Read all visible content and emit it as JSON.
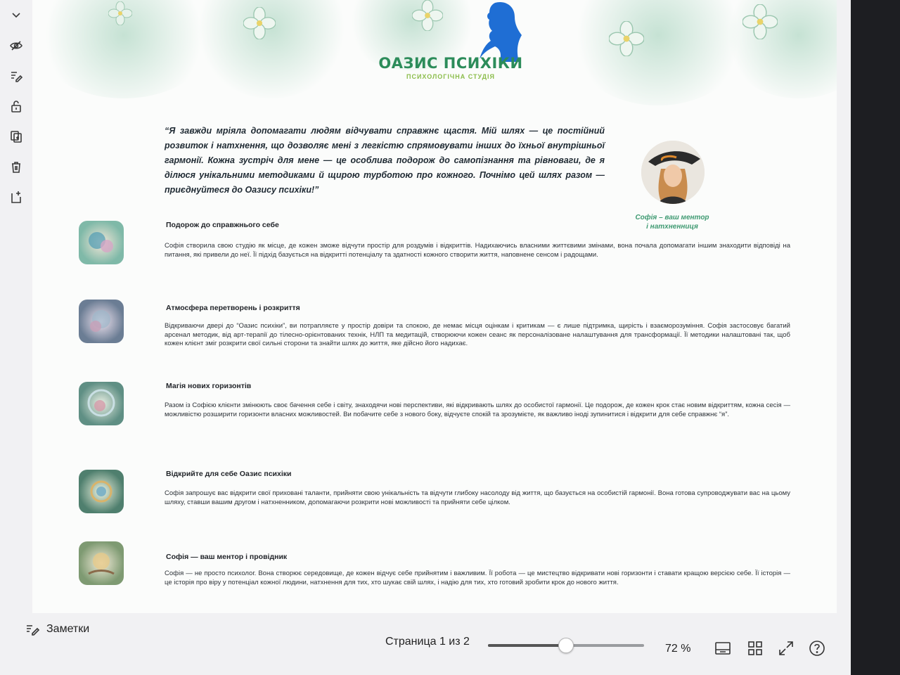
{
  "toolbar": {
    "items": [
      {
        "icon": "chevron-down-icon"
      },
      {
        "icon": "eye-off-icon"
      },
      {
        "icon": "edit-text-icon"
      },
      {
        "icon": "unlock-icon"
      },
      {
        "icon": "duplicate-page-icon"
      },
      {
        "icon": "trash-icon"
      },
      {
        "icon": "add-page-icon"
      }
    ]
  },
  "document": {
    "logo_title": "ОАЗИС ПСИХІКИ",
    "logo_subtitle": "ПСИХОЛОГІЧНА СТУДІЯ",
    "quote": "“Я завжди мріяла допомагати людям відчувати справжнє щастя. Мій шлях — це постійний розвиток і натхнення, що дозволяє мені з легкістю спрямовувати інших до їхньої внутрішньої гармонії. Кожна зустріч для мене — це особлива подорож до самопізнання та рівноваги, де я ділюся унікальними методиками й щирою турботою про кожного. Почнімо цей шлях разом — приєднуйтеся до Оазису психіки!”",
    "portrait_caption_line1": "Софія – ваш ментор",
    "portrait_caption_line2": "і натхненниця",
    "sections": [
      {
        "title": "Подорож до справжнього себе",
        "text": "Софія створила свою студію як місце, де кожен зможе відчути простір для роздумів і відкриттів. Надихаючись власними життєвими змінами, вона почала допомагати іншим знаходити відповіді на питання, які привели до неї. Її підхід базується на відкритті потенціалу та здатності кожного створити життя, наповнене сенсом і радощами."
      },
      {
        "title": "Атмосфера перетворень і розкриття",
        "text": "Відкриваючи двері до “Оазис психіки”, ви потрапляєте у простір довіри та спокою, де немає місця оцінкам і критикам — є лише підтримка, щирість і взаєморозуміння. Софія застосовує багатий арсенал методик, від арт-терапії до тілесно-орієнтованих технік, НЛП та медитацій, створюючи кожен сеанс як персоналізоване налаштування для трансформації. Її методики налаштовані так, щоб кожен клієнт зміг розкрити свої сильні сторони та знайти шлях до життя, яке дійсно його надихає."
      },
      {
        "title": "Магія нових горизонтів",
        "text": "Разом із Софією клієнти змінюють своє бачення себе і світу, знаходячи нові перспективи, які відкривають шлях до особистої гармонії. Це подорож, де кожен крок стає новим відкриттям, кожна сесія — можливістю розширити горизонти власних можливостей. Ви побачите себе з нового боку, відчуєте спокій та зрозумієте, як важливо іноді зупинитися і відкрити для себе справжнє “я”."
      },
      {
        "title": "Відкрийте для себе Оазис психіки",
        "text": "Софія запрошує вас відкрити свої приховані таланти, прийняти свою унікальність та відчути глибоку насолоду від життя, що базується на особистій гармонії. Вона готова супроводжувати вас на цьому шляху, ставши вашим другом і натхненником, допомагаючи розкрити нові можливості та прийняти себе цілком."
      },
      {
        "title": "Софія — ваш ментор і провідник",
        "text": "Софія — не просто психолог. Вона створює середовище, де кожен відчує себе прийнятим і важливим. Її робота — це мистецтво відкривати нові горизонти і ставати кращою версією себе. Її історія — це історія про віру у потенціал кожної людини, натхнення для тих, хто шукає свій шлях, і надію для тих, хто готовий зробити крок до нового життя."
      }
    ]
  },
  "status_bar": {
    "notes_label": "Заметки",
    "page_indicator": "Страница 1 из 2",
    "zoom_level": "72 %",
    "zoom_slider_position": 0.5,
    "icons": [
      "notes-icon",
      "desktop-view-icon",
      "grid-view-icon",
      "fullscreen-icon",
      "help-icon"
    ]
  },
  "colors": {
    "brand_green": "#2c8c5a",
    "brand_light_green": "#8bbd4a",
    "silhouette_blue": "#1f6ed4",
    "caption_green": "#3f9a72"
  }
}
